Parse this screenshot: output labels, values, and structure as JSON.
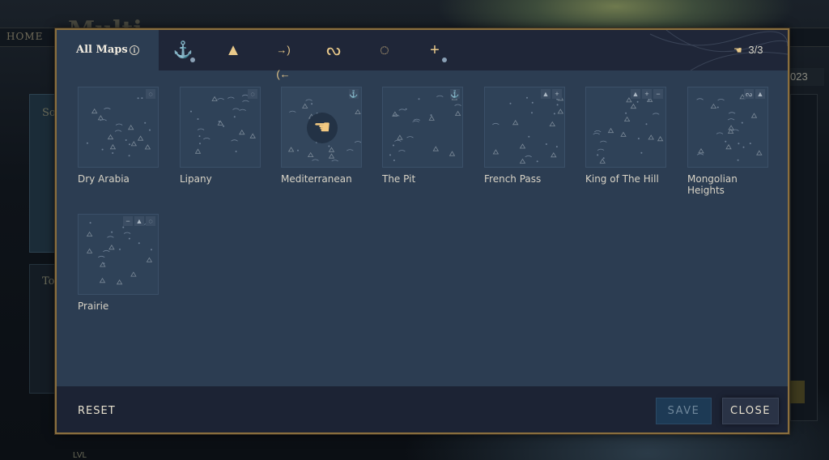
{
  "background": {
    "home_label": "HOME",
    "title_partial": "Multi",
    "side_text_1": "So",
    "side_text_2": "To",
    "year_partial": "023",
    "lvl_label": "LVL"
  },
  "tabs": {
    "all_maps_label": "All Maps",
    "info_glyph": "i",
    "filters": [
      {
        "name": "anchor-icon",
        "glyph": "⚓",
        "has_dot": true
      },
      {
        "name": "mountain-icon",
        "glyph": "▲",
        "has_dot": false
      },
      {
        "name": "pass-icon",
        "glyph": "→)(←",
        "has_dot": false
      },
      {
        "name": "river-icon",
        "glyph": "ᔓ",
        "has_dot": false
      },
      {
        "name": "circle-bracket-icon",
        "glyph": "◌",
        "has_dot": false
      },
      {
        "name": "plus-icon",
        "glyph": "+",
        "has_dot": true
      }
    ],
    "counter": "3/3"
  },
  "maps": [
    {
      "name": "Dry Arabia",
      "icons": [
        "◌"
      ],
      "excluded": false
    },
    {
      "name": "Lipany",
      "icons": [
        "◌"
      ],
      "excluded": false
    },
    {
      "name": "Mediterranean",
      "icons": [
        "⚓"
      ],
      "excluded": true
    },
    {
      "name": "The Pit",
      "icons": [
        "⚓"
      ],
      "excluded": false
    },
    {
      "name": "French Pass",
      "icons": [
        "▲",
        "+"
      ],
      "excluded": false
    },
    {
      "name": "King of The Hill",
      "icons": [
        "▲",
        "+",
        "−"
      ],
      "excluded": false
    },
    {
      "name": "Mongolian Heights",
      "icons": [
        "ᔓ",
        "▲"
      ],
      "excluded": false
    },
    {
      "name": "Prairie",
      "icons": [
        "−",
        "▲",
        "◌"
      ],
      "excluded": false
    }
  ],
  "footer": {
    "reset_label": "RESET",
    "save_label": "SAVE",
    "close_label": "CLOSE"
  },
  "colors": {
    "accent_gold": "#e9c98a",
    "modal_border": "#8a6f3e",
    "panel_bg": "#2c3d52"
  }
}
